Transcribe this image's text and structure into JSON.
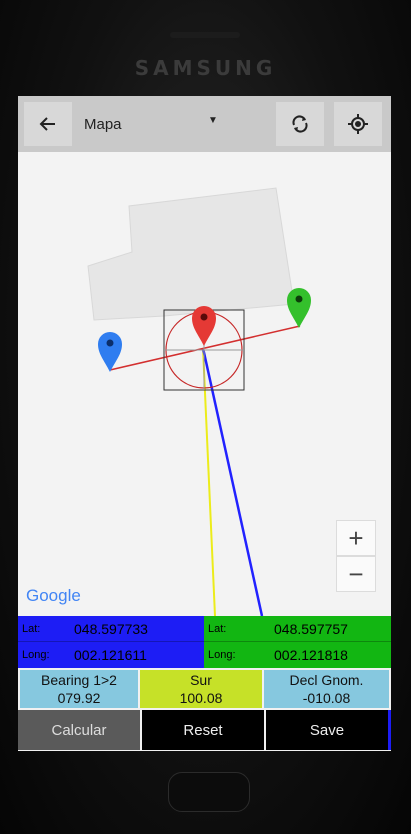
{
  "device": {
    "brand": "SAMSUNG"
  },
  "toolbar": {
    "back_icon": "arrow-left-icon",
    "title": "Mapa",
    "dropdown_icon": "triangle-down-icon",
    "sync_icon": "sync-icon",
    "locate_icon": "my-location-icon"
  },
  "map": {
    "attribution": "Google",
    "zoom_in_label": "+",
    "zoom_out_label": "−",
    "markers": [
      {
        "name": "blue",
        "color": "#2f7df0"
      },
      {
        "name": "red",
        "color": "#e53935"
      },
      {
        "name": "green",
        "color": "#34c02c"
      }
    ]
  },
  "point1": {
    "lat_label": "Lat:",
    "lat": "048.597733",
    "long_label": "Long:",
    "long": "002.121611",
    "color": "#1d1df5"
  },
  "point2": {
    "lat_label": "Lat:",
    "lat": "048.597757",
    "long_label": "Long:",
    "long": "002.121818",
    "color": "#12b612"
  },
  "results": {
    "bearing_label": "Bearing 1>2",
    "bearing_value": "079.92",
    "sur_label": "Sur",
    "sur_value": "100.08",
    "decl_label": "Decl Gnom.",
    "decl_value": "-010.08"
  },
  "buttons": {
    "calcular": "Calcular",
    "reset": "Reset",
    "save": "Save"
  }
}
